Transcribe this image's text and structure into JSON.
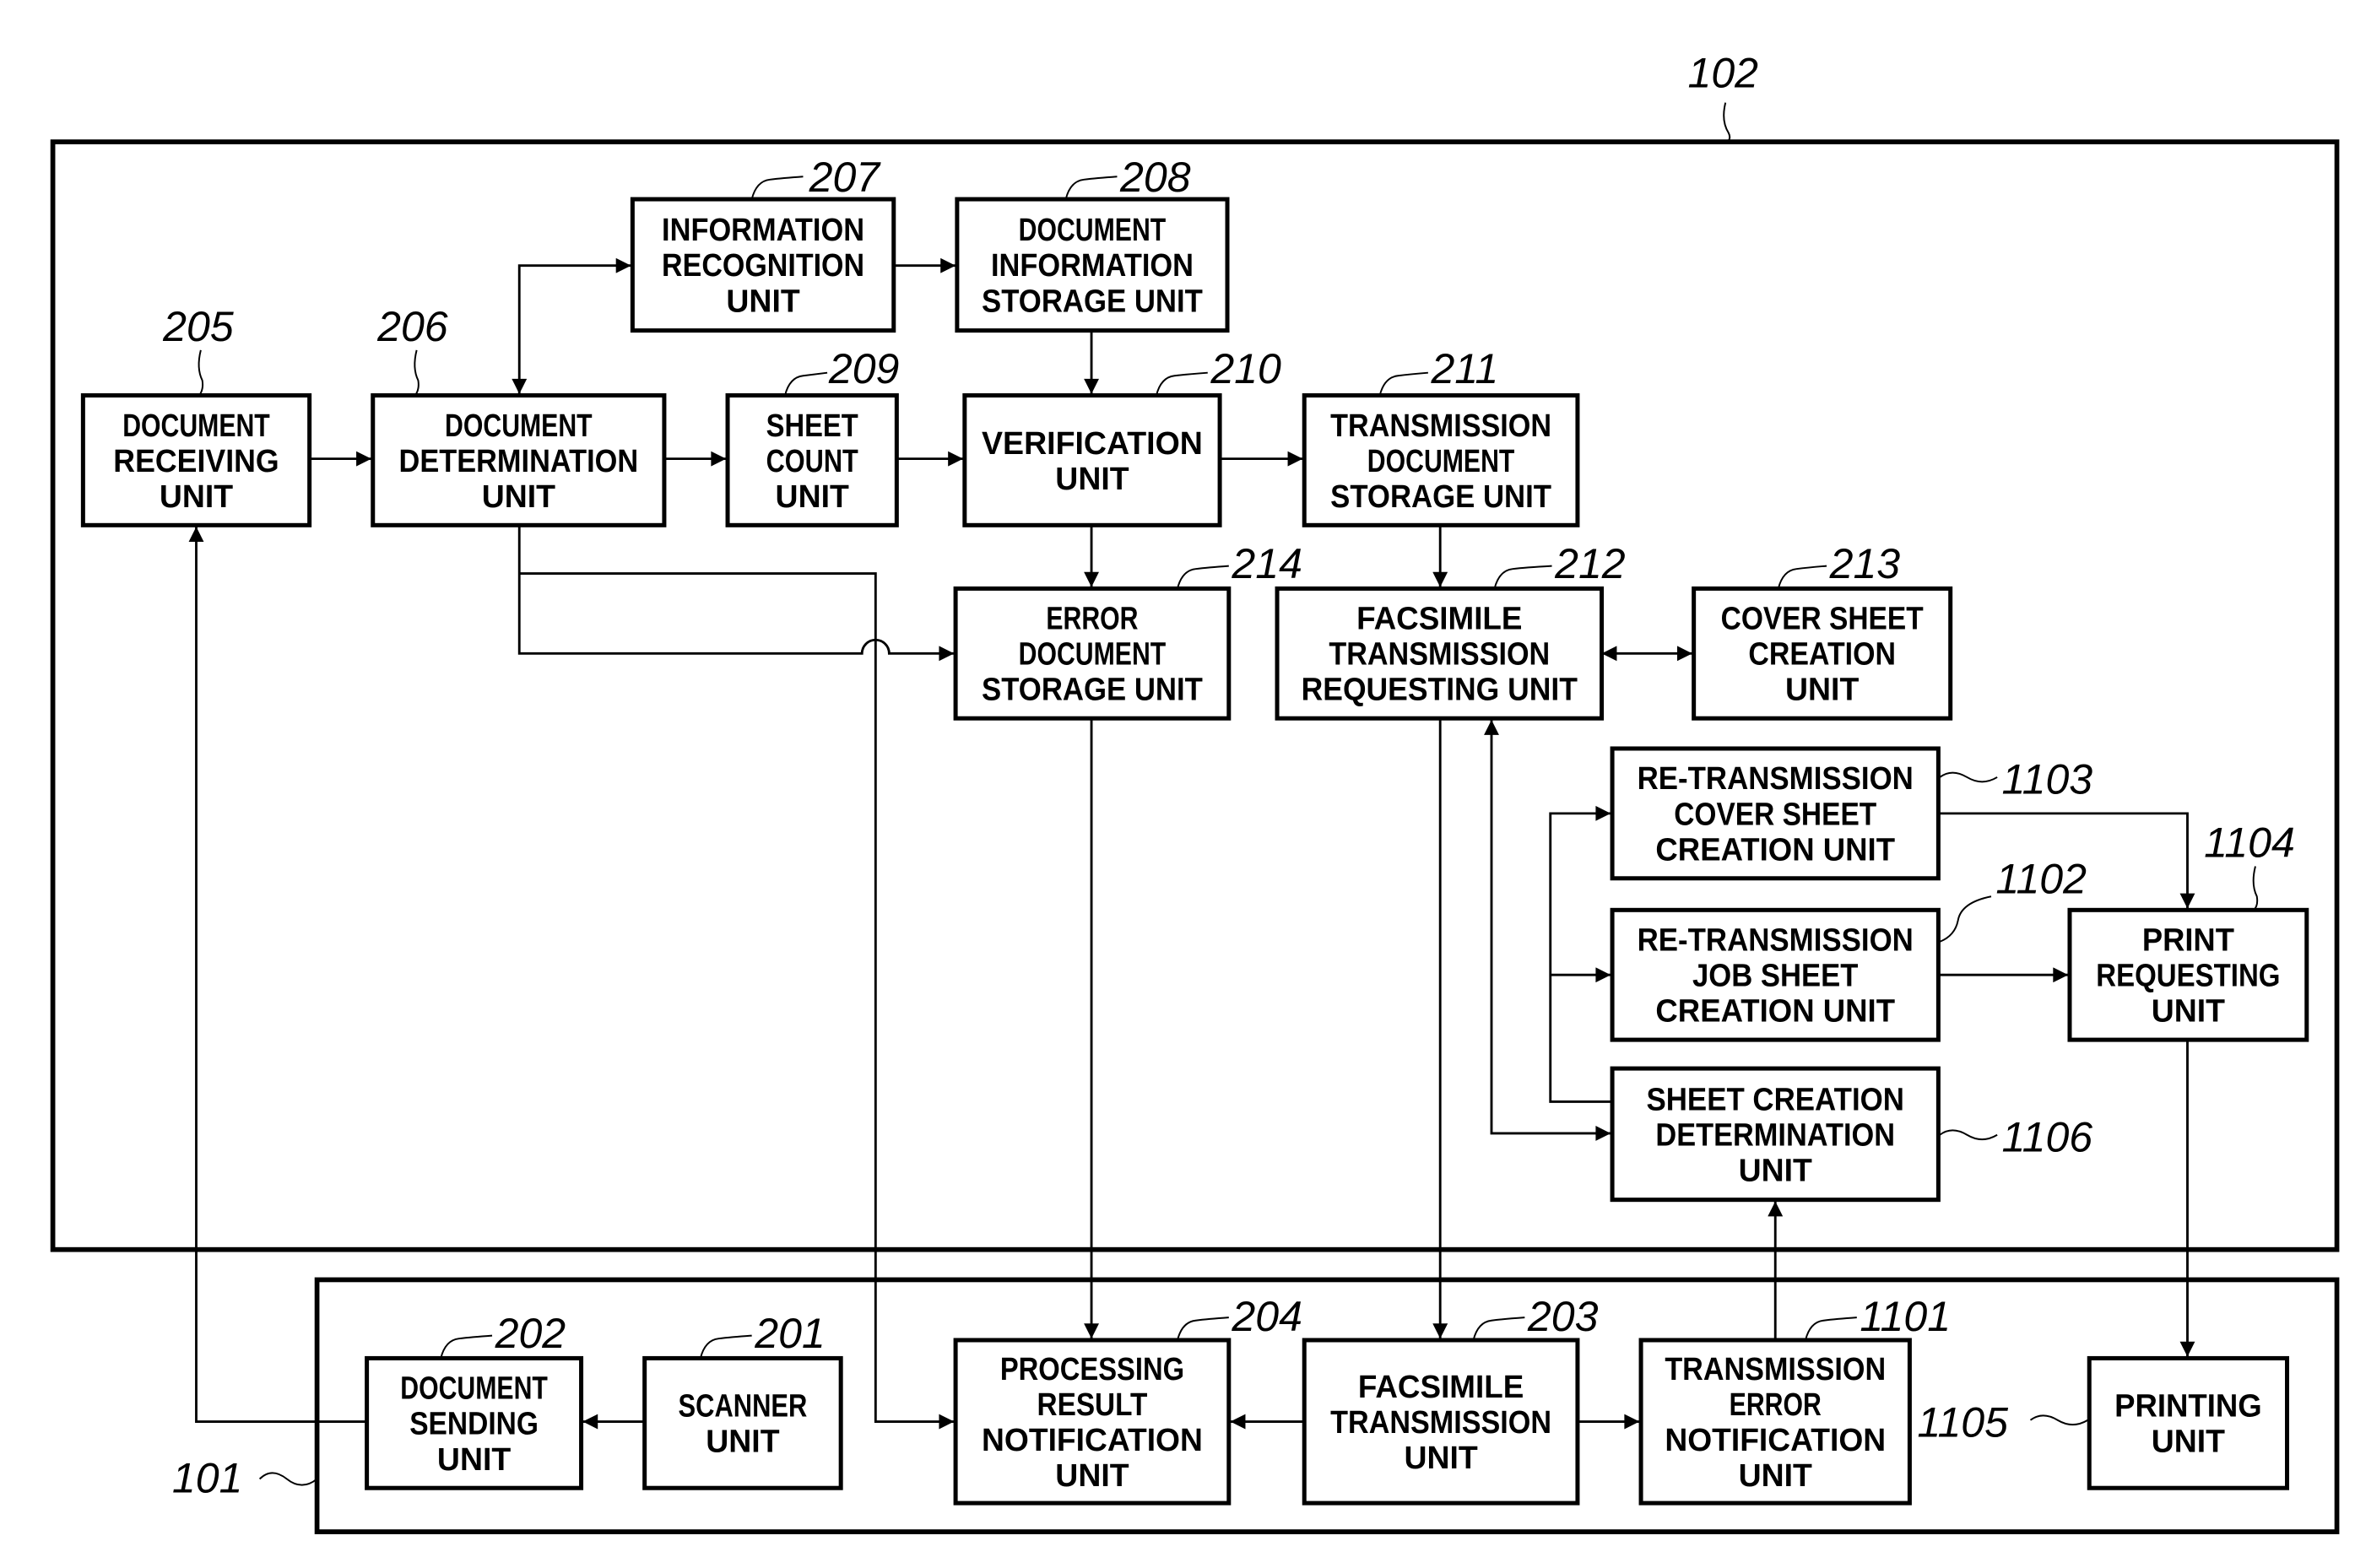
{
  "figure": {
    "containers": [
      {
        "id": "102",
        "ref": "102"
      },
      {
        "id": "101",
        "ref": "101"
      }
    ],
    "units": [
      {
        "id": "205",
        "ref": "205",
        "lines": [
          "DOCUMENT",
          "RECEIVING",
          "UNIT"
        ]
      },
      {
        "id": "206",
        "ref": "206",
        "lines": [
          "DOCUMENT",
          "DETERMINATION",
          "UNIT"
        ]
      },
      {
        "id": "207",
        "ref": "207",
        "lines": [
          "INFORMATION",
          "RECOGNITION",
          "UNIT"
        ]
      },
      {
        "id": "208",
        "ref": "208",
        "lines": [
          "DOCUMENT",
          "INFORMATION",
          "STORAGE UNIT"
        ]
      },
      {
        "id": "209",
        "ref": "209",
        "lines": [
          "SHEET",
          "COUNT",
          "UNIT"
        ]
      },
      {
        "id": "210",
        "ref": "210",
        "lines": [
          "VERIFICATION",
          "UNIT"
        ]
      },
      {
        "id": "211",
        "ref": "211",
        "lines": [
          "TRANSMISSION",
          "DOCUMENT",
          "STORAGE UNIT"
        ]
      },
      {
        "id": "214",
        "ref": "214",
        "lines": [
          "ERROR",
          "DOCUMENT",
          "STORAGE UNIT"
        ]
      },
      {
        "id": "212",
        "ref": "212",
        "lines": [
          "FACSIMILE",
          "TRANSMISSION",
          "REQUESTING UNIT"
        ]
      },
      {
        "id": "213",
        "ref": "213",
        "lines": [
          "COVER SHEET",
          "CREATION",
          "UNIT"
        ]
      },
      {
        "id": "1103",
        "ref": "1103",
        "lines": [
          "RE-TRANSMISSION",
          "COVER SHEET",
          "CREATION UNIT"
        ]
      },
      {
        "id": "1102",
        "ref": "1102",
        "lines": [
          "RE-TRANSMISSION",
          "JOB SHEET",
          "CREATION UNIT"
        ]
      },
      {
        "id": "1104",
        "ref": "1104",
        "lines": [
          "PRINT",
          "REQUESTING",
          "UNIT"
        ]
      },
      {
        "id": "1106",
        "ref": "1106",
        "lines": [
          "SHEET CREATION",
          "DETERMINATION",
          "UNIT"
        ]
      },
      {
        "id": "202",
        "ref": "202",
        "lines": [
          "DOCUMENT",
          "SENDING",
          "UNIT"
        ]
      },
      {
        "id": "201",
        "ref": "201",
        "lines": [
          "SCANNER",
          "UNIT"
        ]
      },
      {
        "id": "204",
        "ref": "204",
        "lines": [
          "PROCESSING",
          "RESULT",
          "NOTIFICATION",
          "UNIT"
        ]
      },
      {
        "id": "203",
        "ref": "203",
        "lines": [
          "FACSIMILE",
          "TRANSMISSION",
          "UNIT"
        ]
      },
      {
        "id": "1101",
        "ref": "1101",
        "lines": [
          "TRANSMISSION",
          "ERROR",
          "NOTIFICATION",
          "UNIT"
        ]
      },
      {
        "id": "1105",
        "ref": "1105",
        "lines": [
          "PRINTING",
          "UNIT"
        ]
      }
    ],
    "connections": [
      {
        "from": "205",
        "to": "206",
        "type": "arrow"
      },
      {
        "from": "206",
        "to": "207",
        "type": "bidirectional"
      },
      {
        "from": "207",
        "to": "208",
        "type": "arrow"
      },
      {
        "from": "206",
        "to": "209",
        "type": "arrow"
      },
      {
        "from": "209",
        "to": "210",
        "type": "arrow"
      },
      {
        "from": "208",
        "to": "210",
        "type": "arrow"
      },
      {
        "from": "210",
        "to": "211",
        "type": "arrow"
      },
      {
        "from": "210",
        "to": "214",
        "type": "arrow"
      },
      {
        "from": "206",
        "to": "214",
        "type": "arrow"
      },
      {
        "from": "206",
        "to": "204",
        "type": "arrow"
      },
      {
        "from": "211",
        "to": "212",
        "type": "arrow"
      },
      {
        "from": "212",
        "to": "213",
        "type": "bidirectional"
      },
      {
        "from": "212",
        "to": "203",
        "type": "arrow"
      },
      {
        "from": "214",
        "to": "204",
        "type": "arrow"
      },
      {
        "from": "1106",
        "to": "212",
        "type": "bidirectional"
      },
      {
        "from": "1106",
        "to": "1103",
        "type": "arrow"
      },
      {
        "from": "1106",
        "to": "1102",
        "type": "arrow"
      },
      {
        "from": "1103",
        "to": "1104",
        "type": "arrow"
      },
      {
        "from": "1102",
        "to": "1104",
        "type": "arrow"
      },
      {
        "from": "1104",
        "to": "1105",
        "type": "arrow"
      },
      {
        "from": "1101",
        "to": "1106",
        "type": "arrow"
      },
      {
        "from": "201",
        "to": "202",
        "type": "arrow"
      },
      {
        "from": "202",
        "to": "205",
        "type": "arrow"
      },
      {
        "from": "203",
        "to": "204",
        "type": "arrow"
      },
      {
        "from": "203",
        "to": "1101",
        "type": "arrow"
      }
    ]
  }
}
